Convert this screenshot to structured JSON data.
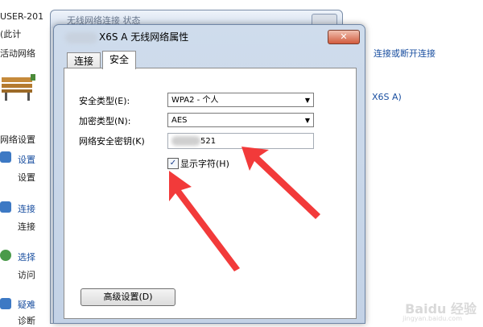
{
  "background": {
    "user_label": "USER-201",
    "computer_label": "(此计",
    "active_network": "活动网络",
    "network_settings": "网络设置",
    "connect_disconnect_link": "连接或断开连接",
    "network_name_fragment": "X6S A)",
    "items": [
      {
        "title": "设置",
        "desc": "设置"
      },
      {
        "title": "连接",
        "desc": "连接"
      },
      {
        "title": "选择",
        "desc": "访问"
      },
      {
        "title": "疑难",
        "desc": "诊断"
      }
    ]
  },
  "back_window": {
    "title": "无线网络连接 状态"
  },
  "dialog": {
    "title": "X6S A 无线网络属性",
    "close_label": "✕",
    "tabs": [
      {
        "label": "连接",
        "active": false
      },
      {
        "label": "安全",
        "active": true
      }
    ],
    "security_type_label": "安全类型(E):",
    "security_type_value": "WPA2 - 个人",
    "encryption_type_label": "加密类型(N):",
    "encryption_type_value": "AES",
    "key_label": "网络安全密钥(K)",
    "key_value_visible": "521",
    "show_chars_label": "显示字符(H)",
    "show_chars_checked": true,
    "advanced_button": "高级设置(D)"
  },
  "watermark": {
    "text": "Baidu 经验",
    "sub": "jingyan.baidu.com"
  },
  "colors": {
    "arrow": "#f23a3a",
    "link": "#1a4fa0",
    "dialog_frame": "#c3d2e6"
  }
}
